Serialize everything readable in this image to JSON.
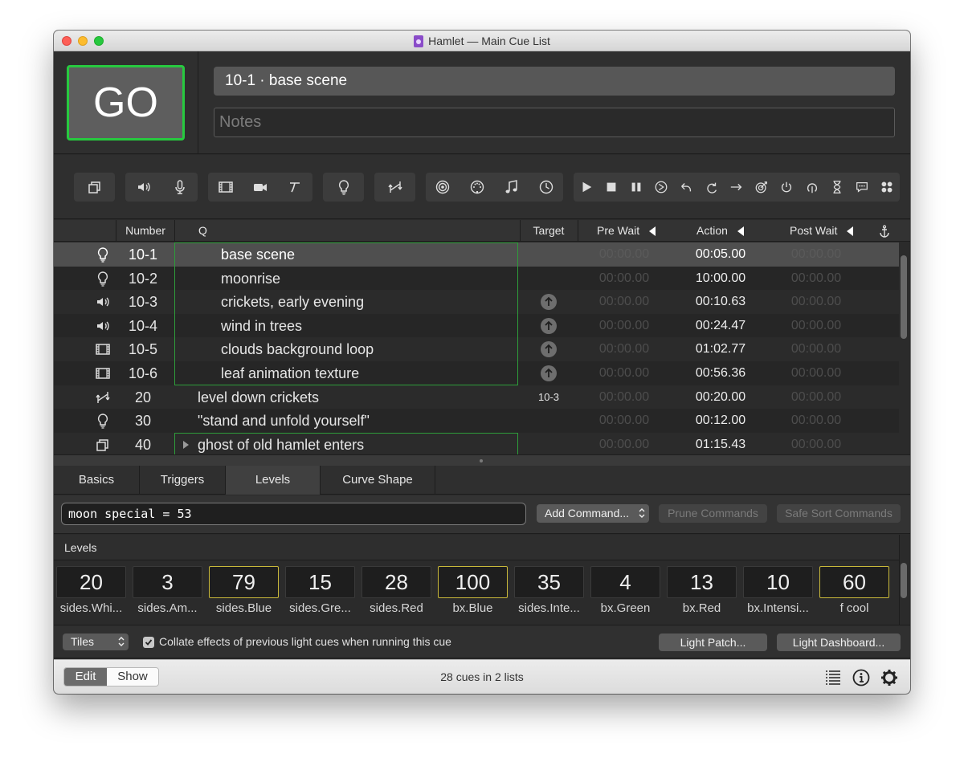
{
  "window": {
    "title": "Hamlet — Main Cue List"
  },
  "go": {
    "label": "GO"
  },
  "current_cue": {
    "name": "10-1 · base scene",
    "notes_placeholder": "Notes"
  },
  "toolbar_icons": [
    "group-icon",
    "audio-icon",
    "mic-icon",
    "video-icon",
    "camera-icon",
    "text-icon",
    "light-icon",
    "fade-icon",
    "network-icon",
    "midi-icon",
    "midi-file-icon",
    "timecode-icon",
    "start-icon",
    "stop-icon",
    "pause-icon",
    "load-icon",
    "reset-icon",
    "devamp-icon",
    "goto-icon",
    "target-icon",
    "arm-icon",
    "disarm-icon",
    "wait-icon",
    "memo-icon",
    "script-icon"
  ],
  "columns": {
    "number": "Number",
    "q": "Q",
    "target": "Target",
    "pre_wait": "Pre Wait",
    "action": "Action",
    "post_wait": "Post Wait"
  },
  "cues": [
    {
      "type": "light-icon",
      "number": "10-1",
      "q": "base scene",
      "target": "",
      "target_kind": "none",
      "pre_wait": "00:00.00",
      "action": "00:05.00",
      "post_wait": "00:00.00"
    },
    {
      "type": "light-icon",
      "number": "10-2",
      "q": "moonrise",
      "target": "",
      "target_kind": "none",
      "pre_wait": "00:00.00",
      "action": "10:00.00",
      "post_wait": "00:00.00"
    },
    {
      "type": "audio-icon",
      "number": "10-3",
      "q": "crickets, early evening",
      "target": "",
      "target_kind": "arrow",
      "pre_wait": "00:00.00",
      "action": "00:10.63",
      "post_wait": "00:00.00"
    },
    {
      "type": "audio-icon",
      "number": "10-4",
      "q": "wind in trees",
      "target": "",
      "target_kind": "arrow",
      "pre_wait": "00:00.00",
      "action": "00:24.47",
      "post_wait": "00:00.00"
    },
    {
      "type": "video-icon",
      "number": "10-5",
      "q": "clouds background loop",
      "target": "",
      "target_kind": "arrow",
      "pre_wait": "00:00.00",
      "action": "01:02.77",
      "post_wait": "00:00.00"
    },
    {
      "type": "video-icon",
      "number": "10-6",
      "q": "leaf animation texture",
      "target": "",
      "target_kind": "arrow",
      "pre_wait": "00:00.00",
      "action": "00:56.36",
      "post_wait": "00:00.00"
    },
    {
      "type": "fade-icon",
      "number": "20",
      "q": "level down crickets",
      "target": "10-3",
      "target_kind": "text",
      "pre_wait": "00:00.00",
      "action": "00:20.00",
      "post_wait": "00:00.00"
    },
    {
      "type": "light-icon",
      "number": "30",
      "q": "\"stand and unfold yourself\"",
      "target": "",
      "target_kind": "none",
      "pre_wait": "00:00.00",
      "action": "00:12.00",
      "post_wait": "00:00.00"
    },
    {
      "type": "group-icon",
      "number": "40",
      "q": "ghost of old hamlet enters",
      "target": "",
      "target_kind": "none",
      "pre_wait": "00:00.00",
      "action": "01:15.43",
      "post_wait": "00:00.00"
    }
  ],
  "tabs": [
    "Basics",
    "Triggers",
    "Levels",
    "Curve Shape"
  ],
  "active_tab": "Levels",
  "command": {
    "value": "moon special = 53",
    "add_label": "Add Command...",
    "prune_label": "Prune Commands",
    "safe_sort_label": "Safe Sort Commands"
  },
  "levels": {
    "title": "Levels",
    "items": [
      {
        "value": "20",
        "label": "sides.Whi...",
        "highlight": false
      },
      {
        "value": "3",
        "label": "sides.Am...",
        "highlight": false
      },
      {
        "value": "79",
        "label": "sides.Blue",
        "highlight": true
      },
      {
        "value": "15",
        "label": "sides.Gre...",
        "highlight": false
      },
      {
        "value": "28",
        "label": "sides.Red",
        "highlight": false
      },
      {
        "value": "100",
        "label": "bx.Blue",
        "highlight": true
      },
      {
        "value": "35",
        "label": "sides.Inte...",
        "highlight": false
      },
      {
        "value": "4",
        "label": "bx.Green",
        "highlight": false
      },
      {
        "value": "13",
        "label": "bx.Red",
        "highlight": false
      },
      {
        "value": "10",
        "label": "bx.Intensi...",
        "highlight": false
      },
      {
        "value": "60",
        "label": "f cool",
        "highlight": true
      }
    ]
  },
  "options": {
    "view_mode": "Tiles",
    "collate_label": "Collate effects of previous light cues when running this cue",
    "light_patch_label": "Light Patch...",
    "light_dashboard_label": "Light Dashboard..."
  },
  "footer": {
    "edit_label": "Edit",
    "show_label": "Show",
    "status": "28 cues in 2 lists"
  },
  "colors": {
    "go_border": "#27c93f",
    "group_outline": "#2e9c3a",
    "level_highlight": "#c9b93a"
  }
}
